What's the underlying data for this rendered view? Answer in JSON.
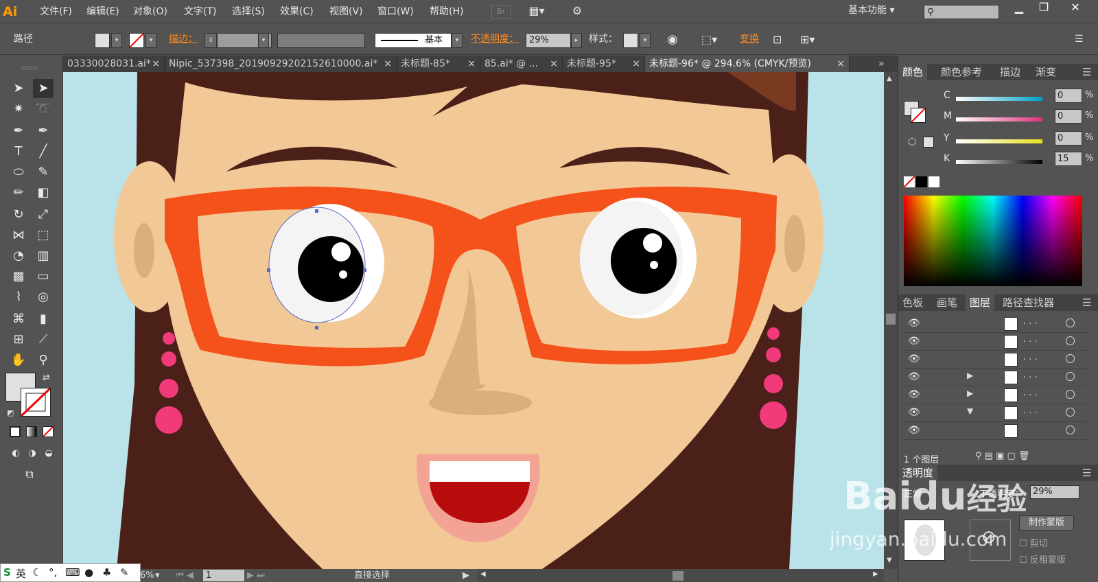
{
  "app": {
    "logo": "Ai",
    "workspace": "基本功能",
    "br_label": "Br"
  },
  "menu": [
    "文件(F)",
    "编辑(E)",
    "对象(O)",
    "文字(T)",
    "选择(S)",
    "效果(C)",
    "视图(V)",
    "窗口(W)",
    "帮助(H)"
  ],
  "control": {
    "selection_label": "路径",
    "stroke_label": "描边：",
    "stroke_style": "基本",
    "opacity_label": "不透明度：",
    "opacity_value": "29%",
    "style_label": "样式：",
    "transform_label": "变换"
  },
  "tabs": [
    "03330028031.ai*",
    "Nipic_537398_20190929202152610000.ai*",
    "未标题-85*",
    "85.ai* @ ...",
    "未标题-95*",
    "未标题-96* @ 294.6% (CMYK/预览)"
  ],
  "tab_close": "×",
  "panel_color": {
    "tabs": [
      "颜色",
      "颜色参考",
      "描边",
      "渐变"
    ],
    "channels": [
      {
        "label": "C",
        "value": "0",
        "unit": "%",
        "color": "#00a0c6"
      },
      {
        "label": "M",
        "value": "0",
        "unit": "%",
        "color": "#e0307a"
      },
      {
        "label": "Y",
        "value": "0",
        "unit": "%",
        "color": "#e6e020"
      },
      {
        "label": "K",
        "value": "15",
        "unit": "%",
        "color": "#000000"
      }
    ]
  },
  "panel_layers": {
    "tabs": [
      "色板",
      "画笔",
      "图层",
      "路径查找器"
    ],
    "rows": [
      {
        "name": ". . ."
      },
      {
        "name": ". . ."
      },
      {
        "name": ". . ."
      },
      {
        "name": ". . ."
      },
      {
        "name": ". . ."
      },
      {
        "name": ". . ."
      },
      {
        "name": ""
      },
      {
        "name": ""
      }
    ],
    "footer": "1 个图层"
  },
  "panel_transparency": {
    "title": "透明度",
    "mode": "正常",
    "opacity_label": "不透明度：",
    "opacity_value": "29%",
    "make_mask": "制作蒙版",
    "clip": "剪切",
    "invert_mask": "反相蒙版"
  },
  "status": {
    "zoom": "6%",
    "page": "1",
    "tool_name": "直接选择"
  },
  "ime": {
    "lang": "英"
  },
  "watermark": {
    "brand": "Baidu",
    "brand_cn": "经验",
    "url": "jingyan.baidu.com"
  },
  "colors": {
    "hair": "#4a2018",
    "skin": "#f2c896",
    "glasses": "#f5521b",
    "bg": "#b9e3e9",
    "earring": "#f03a7a",
    "mouth": "#b80c0c"
  }
}
